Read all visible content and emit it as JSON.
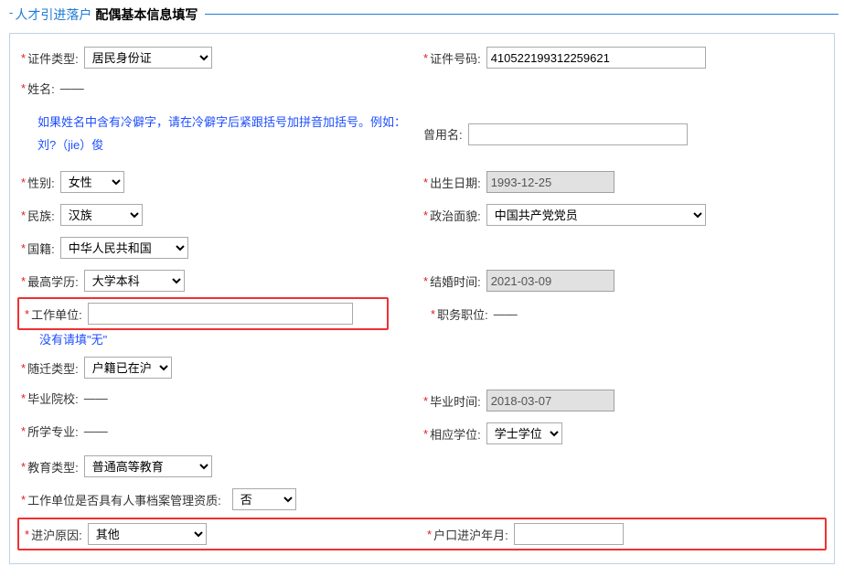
{
  "title": {
    "prefix": "人才引进落户",
    "main": "配偶基本信息填写"
  },
  "hint_rarechar": "如果姓名中含有冷僻字，请在冷僻字后紧跟括号加拼音加括号。例如：刘?（jie）俊",
  "hint_nowork": "没有请填\"无\"",
  "labels": {
    "id_type": "证件类型:",
    "id_no": "证件号码:",
    "name": "姓名:",
    "former_name": "曾用名:",
    "gender": "性别:",
    "birth": "出生日期:",
    "nation": "民族:",
    "political": "政治面貌:",
    "country": "国籍:",
    "edu": "最高学历:",
    "marry_time": "结婚时间:",
    "work_unit": "工作单位:",
    "job": "职务职位:",
    "move_type": "随迁类型:",
    "grad_school": "毕业院校:",
    "grad_time": "毕业时间:",
    "major": "所学专业:",
    "degree": "相应学位:",
    "edu_type": "教育类型:",
    "archive_q": "工作单位是否具有人事档案管理资质:",
    "sh_reason": "进沪原因:",
    "sh_date": "户口进沪年月:"
  },
  "values": {
    "id_type": "居民身份证",
    "id_no": "410522199312259621",
    "name": "——",
    "former_name": "",
    "gender": "女性",
    "birth": "1993-12-25",
    "nation": "汉族",
    "political": "中国共产党党员",
    "country": "中华人民共和国",
    "edu": "大学本科",
    "marry_time": "2021-03-09",
    "work_unit": "",
    "job": "——",
    "move_type": "户籍已在沪",
    "grad_school": "——",
    "grad_time": "2018-03-07",
    "major": "——",
    "degree": "学士学位",
    "edu_type": "普通高等教育",
    "archive_q": "否",
    "sh_reason": "其他",
    "sh_date": ""
  }
}
